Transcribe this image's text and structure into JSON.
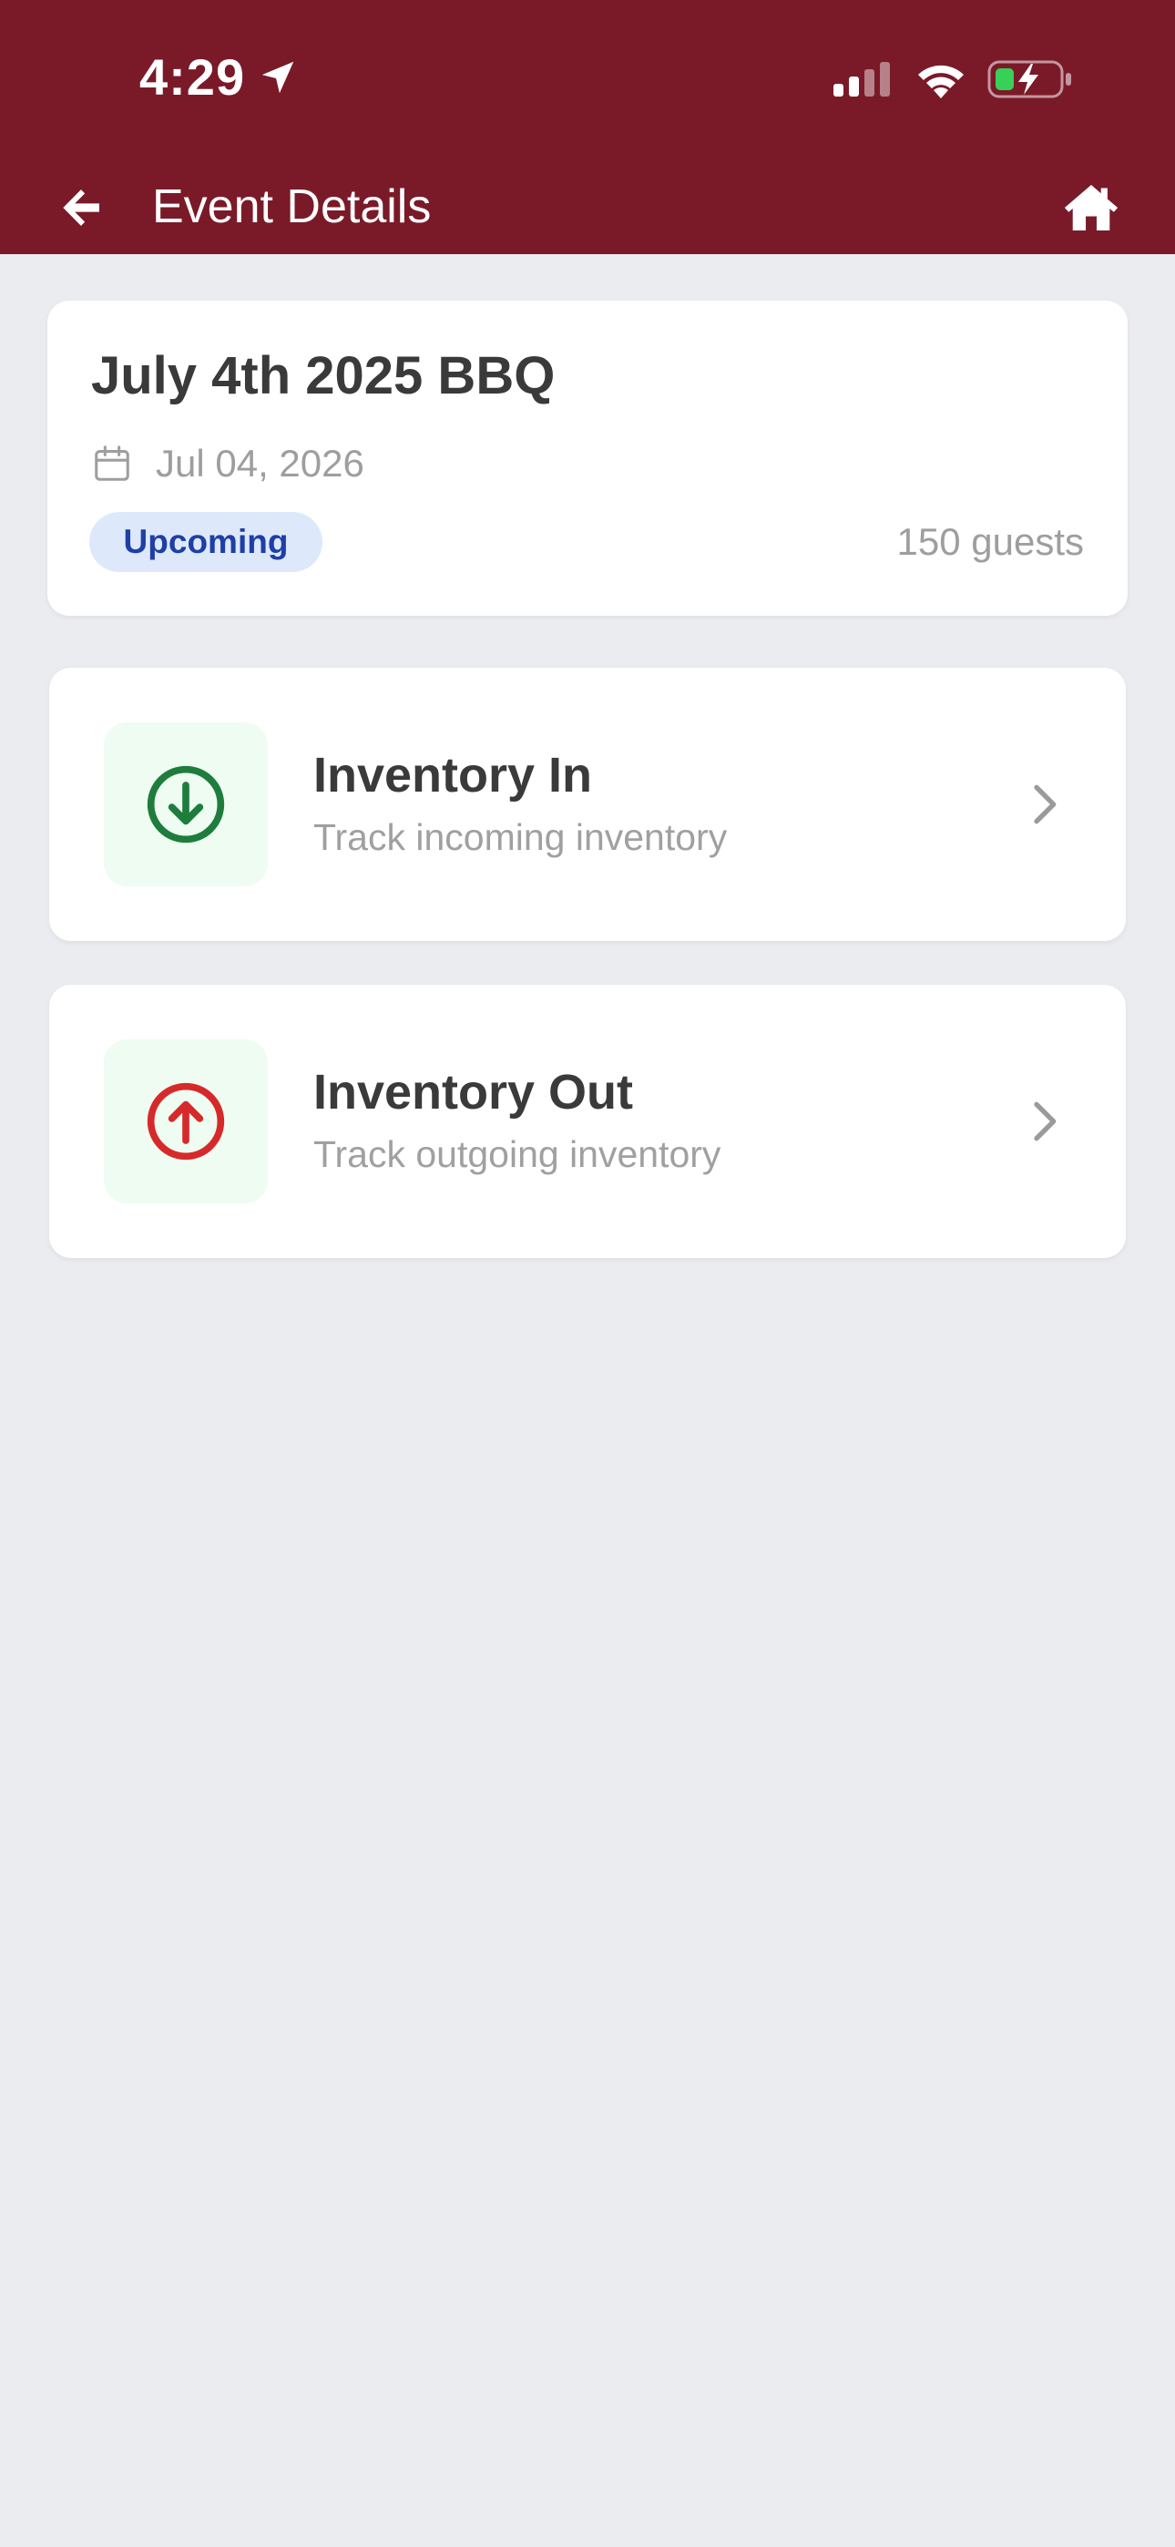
{
  "status_bar": {
    "time": "4:29",
    "location_icon": "location-arrow-icon",
    "signal_icon": "cellular-signal-icon",
    "wifi_icon": "wifi-icon",
    "battery_icon": "battery-charging-icon"
  },
  "header": {
    "title": "Event Details",
    "back_icon": "arrow-left-icon",
    "home_icon": "home-icon",
    "background_color": "#7a1a28"
  },
  "event": {
    "title": "July 4th 2025 BBQ",
    "date": "Jul 04, 2026",
    "date_icon": "calendar-icon",
    "status": "Upcoming",
    "guests": "150 guests"
  },
  "menu": [
    {
      "title": "Inventory In",
      "subtitle": "Track incoming inventory",
      "icon": "arrow-down-circle-icon",
      "icon_color": "#1e7d3c"
    },
    {
      "title": "Inventory Out",
      "subtitle": "Track outgoing inventory",
      "icon": "arrow-up-circle-icon",
      "icon_color": "#d62a2a"
    }
  ],
  "colors": {
    "background": "#ebecf0",
    "badge_background": "#dde9fb",
    "badge_text": "#1f3fa6",
    "icon_box_background": "#eefcf2"
  }
}
